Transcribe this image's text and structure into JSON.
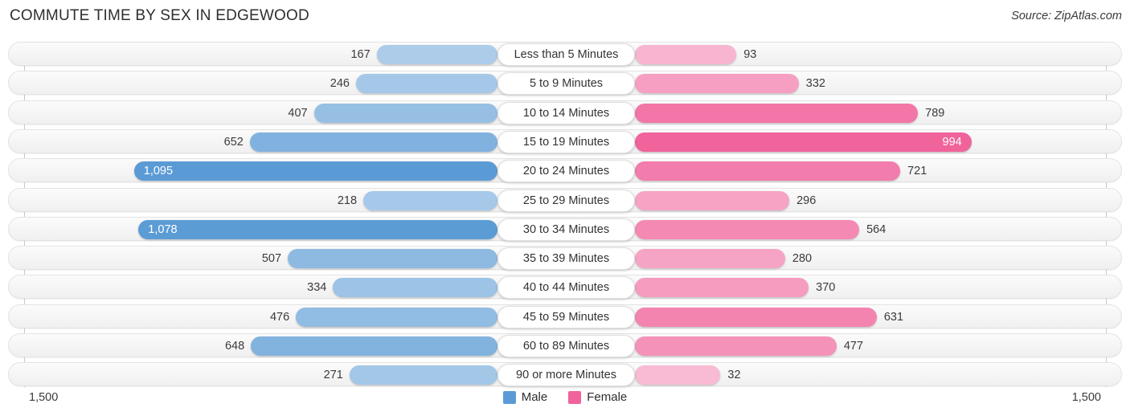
{
  "header": {
    "title": "COMMUTE TIME BY SEX IN EDGEWOOD",
    "source": "Source: ZipAtlas.com"
  },
  "axis": {
    "left_max_label": "1,500",
    "right_max_label": "1,500"
  },
  "legend": {
    "items": [
      {
        "label": "Male",
        "color": "#5b9bd5"
      },
      {
        "label": "Female",
        "color": "#f0639b"
      }
    ]
  },
  "chart_data": {
    "type": "bar",
    "subtype": "diverging-bidirectional-bar",
    "title": "COMMUTE TIME BY SEX IN EDGEWOOD",
    "xlabel": "",
    "ylabel": "",
    "xlim": [
      1500,
      1500
    ],
    "grid": false,
    "legend_position": "bottom-center",
    "categories": [
      "Less than 5 Minutes",
      "5 to 9 Minutes",
      "10 to 14 Minutes",
      "15 to 19 Minutes",
      "20 to 24 Minutes",
      "25 to 29 Minutes",
      "30 to 34 Minutes",
      "35 to 39 Minutes",
      "40 to 44 Minutes",
      "45 to 59 Minutes",
      "60 to 89 Minutes",
      "90 or more Minutes"
    ],
    "series": [
      {
        "name": "Male",
        "direction": "left",
        "color": "#5b9bd5",
        "values": [
          167,
          246,
          407,
          652,
          1095,
          218,
          1078,
          507,
          334,
          476,
          648,
          271
        ],
        "labels": [
          "167",
          "246",
          "407",
          "652",
          "1,095",
          "218",
          "1,078",
          "507",
          "334",
          "476",
          "648",
          "271"
        ]
      },
      {
        "name": "Female",
        "direction": "right",
        "color": "#f0639b",
        "values": [
          93,
          332,
          789,
          994,
          721,
          296,
          564,
          280,
          370,
          631,
          477,
          32
        ],
        "labels": [
          "93",
          "332",
          "789",
          "994",
          "721",
          "296",
          "564",
          "280",
          "370",
          "631",
          "477",
          "32"
        ]
      }
    ]
  }
}
